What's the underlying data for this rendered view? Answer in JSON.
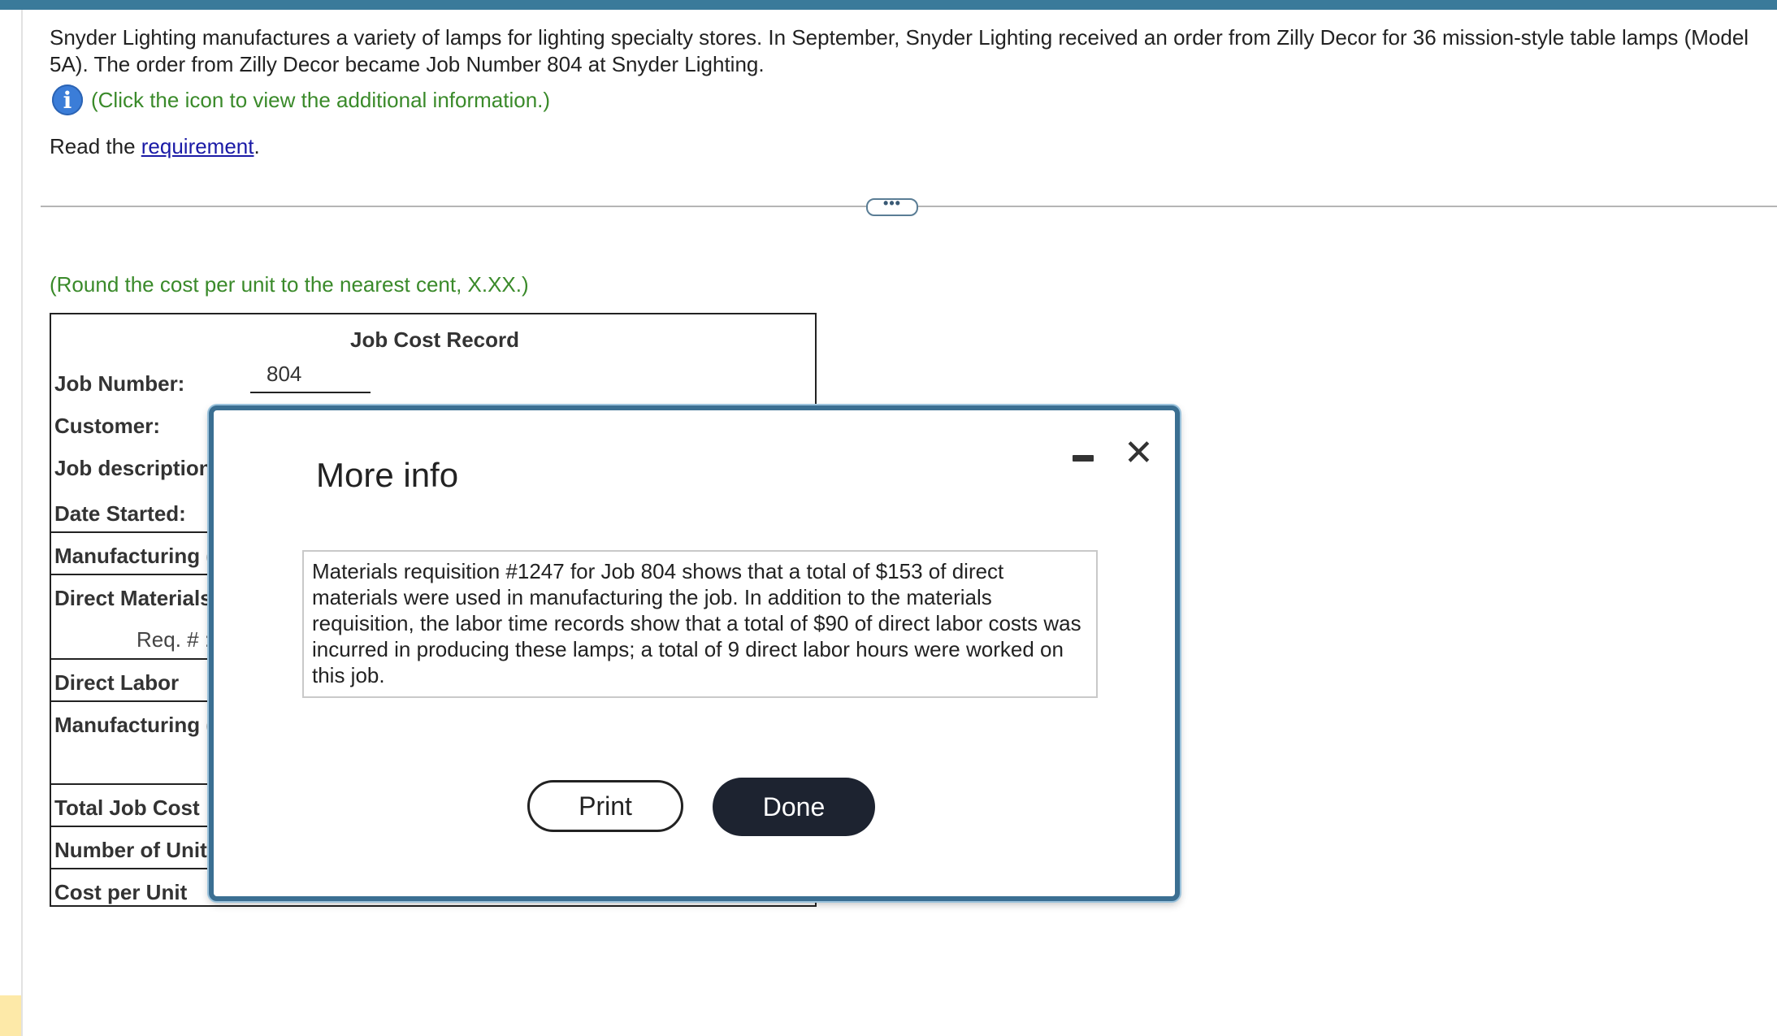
{
  "intro": {
    "text": "Snyder Lighting manufactures a variety of lamps for lighting specialty stores. In September, Snyder Lighting received an order from Zilly Decor for 36 mission-style table lamps (Model 5A). The order from Zilly Decor became Job Number 804 at Snyder Lighting."
  },
  "info": {
    "icon_glyph": "i",
    "text": "(Click the icon to view the additional information.)"
  },
  "requirement": {
    "prefix": "Read the ",
    "link": "requirement",
    "suffix": "."
  },
  "divider": {
    "pill_label": "•••"
  },
  "round_note": "(Round the cost per unit to the nearest cent, X.XX.)",
  "job_cost_record": {
    "title": "Job Cost Record",
    "job_number_label": "Job Number:",
    "job_number_value": "804",
    "customer_label": "Customer:",
    "job_description_label": "Job description",
    "date_started_label": "Date Started:",
    "manufacturing_label_1": "Manufacturing (",
    "direct_materials_label": "Direct Materials",
    "req_label": "Req. # :",
    "direct_labor_label": "Direct Labor",
    "manufacturing_label_2": "Manufacturing (",
    "total_job_cost_label": "Total Job Cost",
    "number_of_units_label": "Number of Unit",
    "cost_per_unit_label": "Cost per Unit"
  },
  "modal": {
    "title": "More info",
    "minimize_glyph": "",
    "close_glyph": "✕",
    "body": "Materials requisition #1247 for Job 804 shows that a total of $153 of direct materials were used in manufacturing the job. In addition to the materials requisition, the labor time records show that a total of $90 of direct labor costs was incurred in producing these lamps; a total of 9 direct labor hours were worked on this job.",
    "print_label": "Print",
    "done_label": "Done"
  }
}
